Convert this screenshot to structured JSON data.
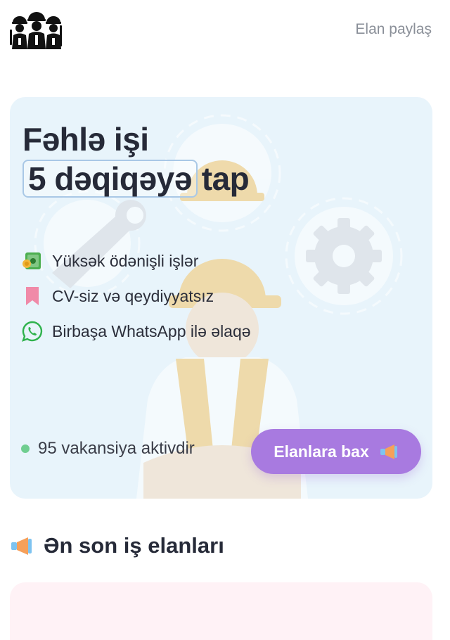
{
  "header": {
    "post_link": "Elan paylaş"
  },
  "hero": {
    "title_line1": "Fəhlə işi",
    "title_highlight": "5 dəqiqəyə",
    "title_suffix": "tap",
    "features": [
      {
        "icon": "money-icon",
        "label": "Yüksək ödənişli işlər"
      },
      {
        "icon": "bookmark-icon",
        "label": "CV-siz və qeydiyyatsız"
      },
      {
        "icon": "whatsapp-icon",
        "label": "Birbaşa WhatsApp ilə əlaqə"
      }
    ],
    "active_text": "95 vakansiya aktivdir",
    "cta_label": "Elanlara bax"
  },
  "section": {
    "title": "Ən son iş elanları"
  },
  "colors": {
    "hero_bg": "#e8f4fb",
    "cta": "#a87ae0",
    "card_bg": "#fff2f6",
    "active_dot": "#6fce90"
  }
}
